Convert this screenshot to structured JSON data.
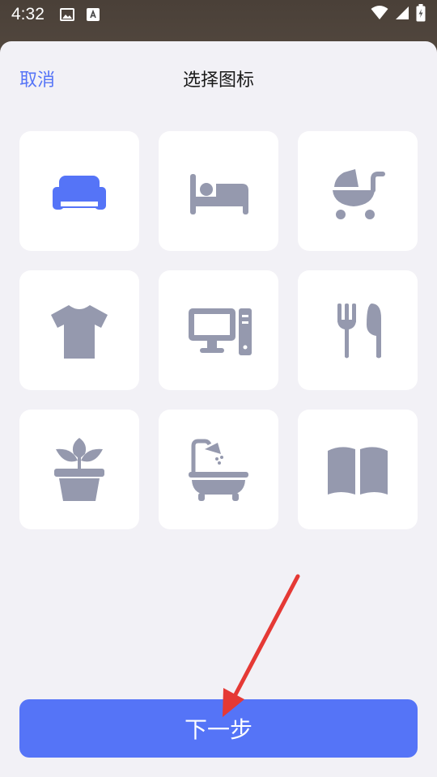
{
  "status_bar": {
    "time": "4:32"
  },
  "header": {
    "cancel_label": "取消",
    "title": "选择图标"
  },
  "icons": [
    {
      "name": "sofa-icon",
      "selected": true
    },
    {
      "name": "bed-icon",
      "selected": false
    },
    {
      "name": "stroller-icon",
      "selected": false
    },
    {
      "name": "tshirt-icon",
      "selected": false
    },
    {
      "name": "desktop-computer-icon",
      "selected": false
    },
    {
      "name": "fork-knife-icon",
      "selected": false
    },
    {
      "name": "potted-plant-icon",
      "selected": false
    },
    {
      "name": "bathtub-icon",
      "selected": false
    },
    {
      "name": "book-icon",
      "selected": false
    }
  ],
  "footer": {
    "next_label": "下一步"
  },
  "colors": {
    "accent": "#5574f7",
    "icon_gray": "#9599ae",
    "sheet_bg": "#f2f1f6",
    "annotation_red": "#e53935"
  }
}
